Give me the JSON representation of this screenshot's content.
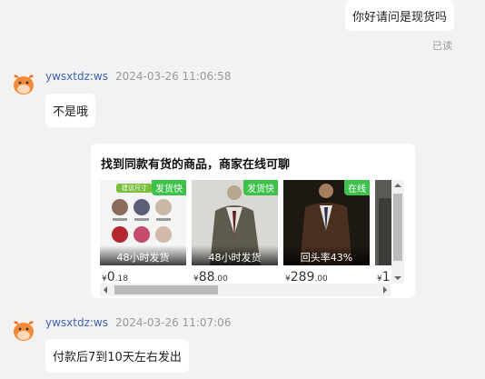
{
  "messages": {
    "outgoing_1": {
      "text": "你好请问是现货吗",
      "status": "已读"
    },
    "incoming_1": {
      "sender": "ywsxtdz:ws",
      "time": "2024-03-26 11:06:58",
      "text": "不是哦"
    },
    "incoming_2": {
      "sender": "ywsxtdz:ws",
      "time": "2024-03-26 11:07:06",
      "text": "付款后7到10天左右发出"
    }
  },
  "card": {
    "title": "找到同款有货的商品，商家在线可聊",
    "products": [
      {
        "tag": "发货快",
        "overlay": "48小时发货",
        "thumb_label": "建议尺寸",
        "price_symbol": "¥",
        "price_int": "0",
        "price_dec": ".18"
      },
      {
        "tag": "发货快",
        "overlay": "48小时发货",
        "price_symbol": "¥",
        "price_int": "88",
        "price_dec": ".00"
      },
      {
        "tag": "在线",
        "overlay": "回头率43%",
        "price_symbol": "¥",
        "price_int": "289",
        "price_dec": ".00"
      },
      {
        "price_symbol": "¥",
        "price_int": "1",
        "price_dec": ""
      }
    ],
    "accent_tag_color": "#3cc24a"
  }
}
